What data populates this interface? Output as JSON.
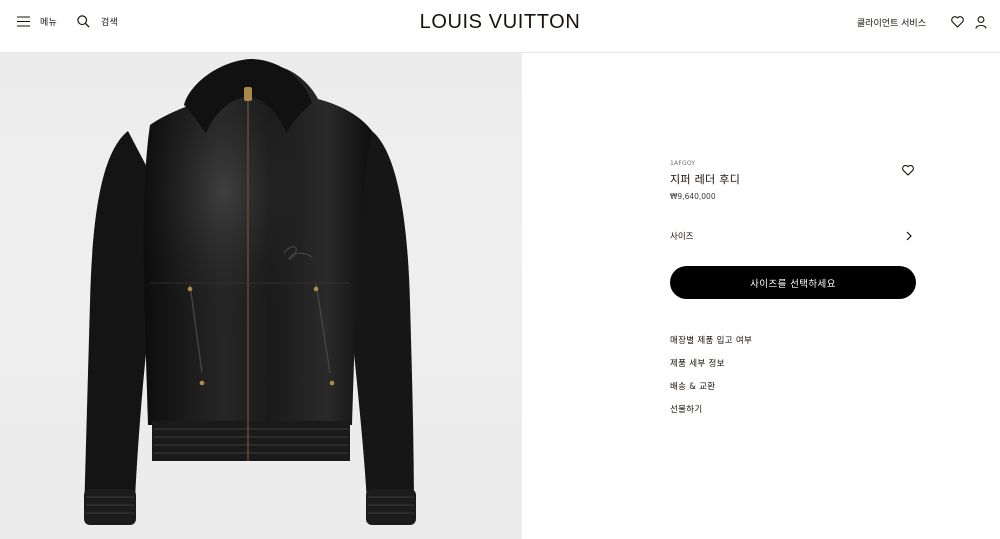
{
  "header": {
    "menu_label": "메뉴",
    "search_label": "검색",
    "brand": "LOUIS VUITTON",
    "client_service": "클라이언트 서비스"
  },
  "product": {
    "sku": "1AFGOY",
    "name": "지퍼 레더 후디",
    "price": "₩9,640,000",
    "size_label": "사이즈",
    "cta_label": "사이즈를 선택하세요",
    "links": [
      "매장별 제품 입고 여부",
      "제품 세부 정보",
      "배송 & 교환",
      "선물하기"
    ]
  },
  "icons": {
    "menu": "hamburger-icon",
    "search": "search-icon",
    "wishlist": "heart-icon",
    "account": "user-icon",
    "size_chevron": "chevron-right-icon"
  }
}
